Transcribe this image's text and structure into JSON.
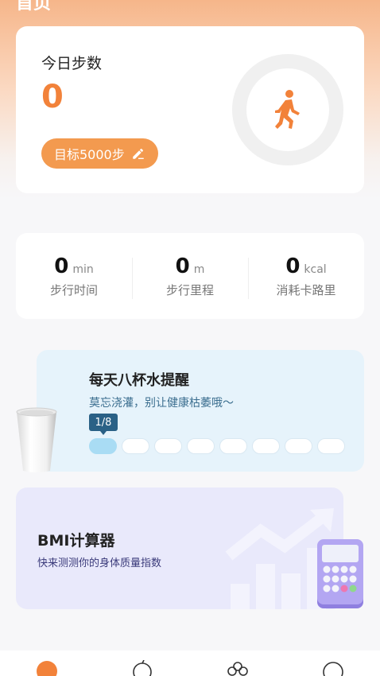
{
  "header": {
    "title": "首页"
  },
  "steps": {
    "label": "今日步数",
    "value": "0",
    "goal_label": "目标5000步",
    "walk_icon": "walking-person-icon",
    "edit_icon": "pencil-icon"
  },
  "stats": [
    {
      "value": "0",
      "unit": "min",
      "label": "步行时间"
    },
    {
      "value": "0",
      "unit": "m",
      "label": "步行里程"
    },
    {
      "value": "0",
      "unit": "kcal",
      "label": "消耗卡路里"
    }
  ],
  "water": {
    "title": "每天八杯水提醒",
    "subtitle": "莫忘浇灌，别让健康枯萎哦～",
    "progress_label": "1/8",
    "cups_total": 8,
    "cups_filled": 1
  },
  "bmi": {
    "title": "BMI计算器",
    "subtitle": "快来测测你的身体质量指数"
  },
  "colors": {
    "accent": "#f2823a",
    "goal_button": "#f39a4f",
    "water_card": "#e6f3fb",
    "bmi_card": "#e9e9fb"
  },
  "nav": [
    "home-icon",
    "fruit-icon",
    "flower-icon",
    "profile-icon"
  ]
}
